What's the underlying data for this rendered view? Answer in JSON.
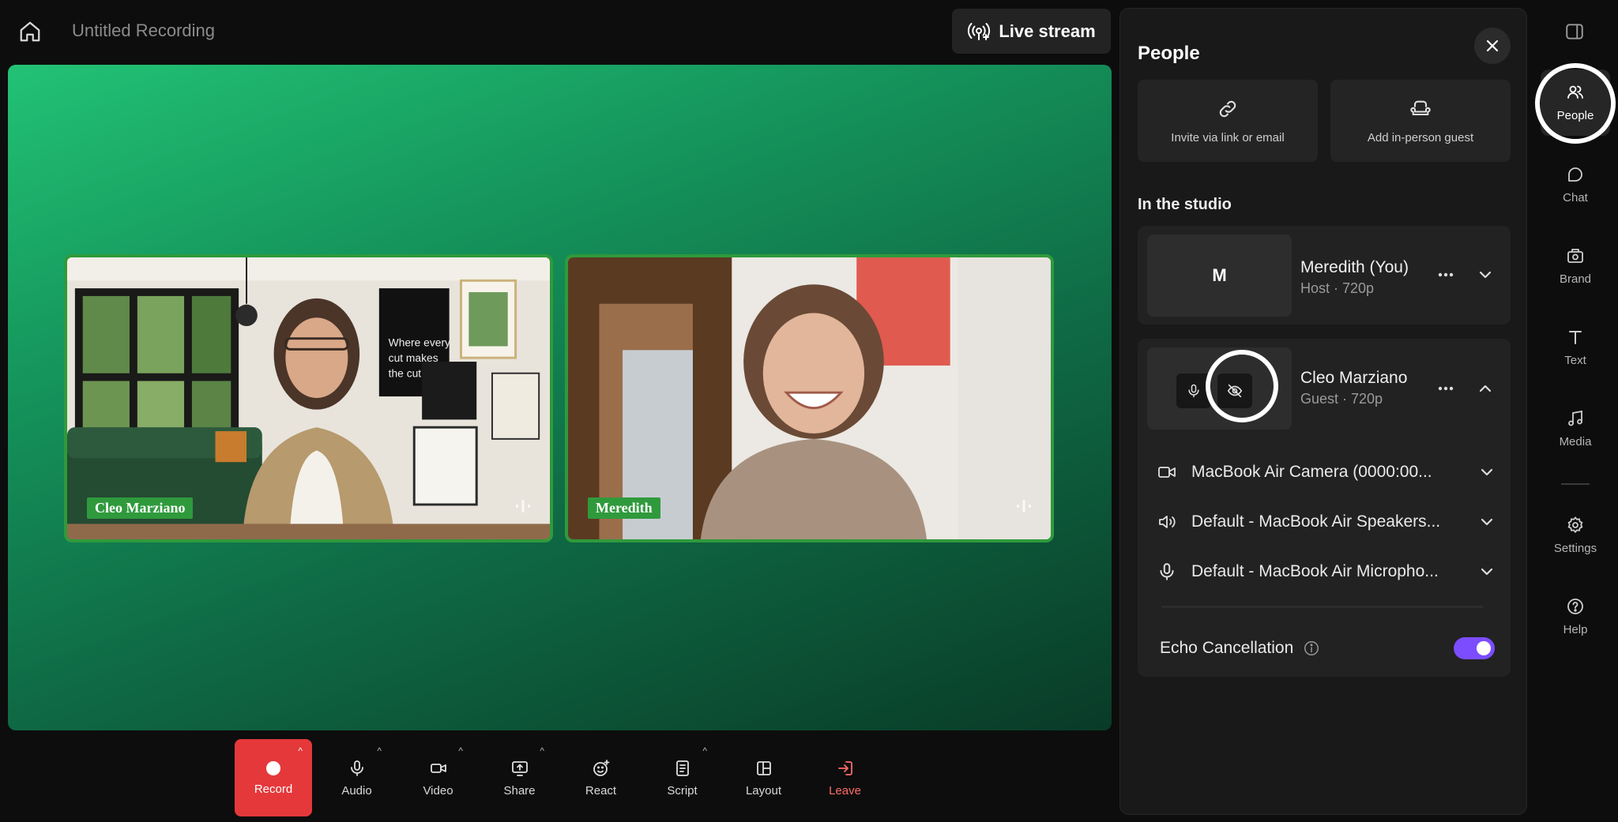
{
  "header": {
    "title": "Untitled Recording",
    "live_stream_label": "Live stream"
  },
  "stage": {
    "participants": [
      {
        "name": "Cleo Marziano"
      },
      {
        "name": "Meredith"
      }
    ]
  },
  "toolbar": {
    "record": "Record",
    "audio": "Audio",
    "video": "Video",
    "share": "Share",
    "react": "React",
    "script": "Script",
    "layout": "Layout",
    "leave": "Leave"
  },
  "panel": {
    "title": "People",
    "invite_label": "Invite via link or email",
    "guest_label": "Add in-person guest",
    "section_title": "In the studio",
    "people": [
      {
        "name": "Meredith (You)",
        "meta": "Host · 720p",
        "initial": "M"
      },
      {
        "name": "Cleo Marziano",
        "meta": "Guest · 720p"
      }
    ],
    "devices": {
      "camera": "MacBook Air Camera (0000:00...",
      "speaker": "Default - MacBook Air Speakers...",
      "mic": "Default - MacBook Air Micropho..."
    },
    "echo_label": "Echo Cancellation",
    "echo_enabled": true
  },
  "rail": {
    "people": "People",
    "chat": "Chat",
    "brand": "Brand",
    "text": "Text",
    "media": "Media",
    "settings": "Settings",
    "help": "Help"
  },
  "colors": {
    "record": "#e5383b",
    "tile_border": "#2f9a3c",
    "toggle_on": "#7c4dff",
    "leave": "#ff6b6b"
  }
}
